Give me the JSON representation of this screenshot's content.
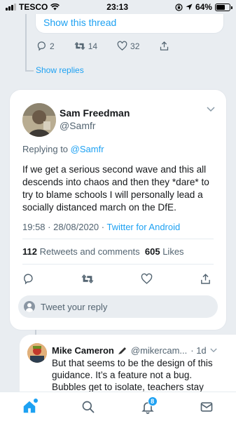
{
  "status_bar": {
    "carrier": "TESCO",
    "time": "23:13",
    "battery": "64%",
    "battery_level": 0.64
  },
  "previous_tweet": {
    "show_thread": "Show this thread",
    "replies": "2",
    "retweets": "14",
    "likes": "32",
    "show_replies": "Show replies"
  },
  "main_tweet": {
    "name": "Sam Freedman",
    "handle": "@Samfr",
    "replying_prefix": "Replying to ",
    "replying_to": "@Samfr",
    "text": "If we get a serious second wave and this all descends into chaos and then they *dare* to try to blame schools I will personally lead a socially distanced march on the DfE.",
    "timestamp": "19:58 · 28/08/2020 · ",
    "source": "Twitter for Android",
    "retweets_count": "112",
    "retweets_label": " Retweets and comments  ",
    "likes_count": "605",
    "likes_label": " Likes",
    "reply_placeholder": "Tweet your reply"
  },
  "reply_tweet": {
    "name": "Mike Cameron",
    "handle": "@mikercam...",
    "time": "· 1d",
    "text": "But that seems to be the design of this guidance. It’s a feature not a bug. Bubbles get to isolate, teachers stay"
  },
  "bottom_nav": {
    "notifications_badge": "8"
  },
  "colors": {
    "accent": "#1da1f2",
    "secondary_text": "#536471",
    "background": "#e9edf1"
  }
}
